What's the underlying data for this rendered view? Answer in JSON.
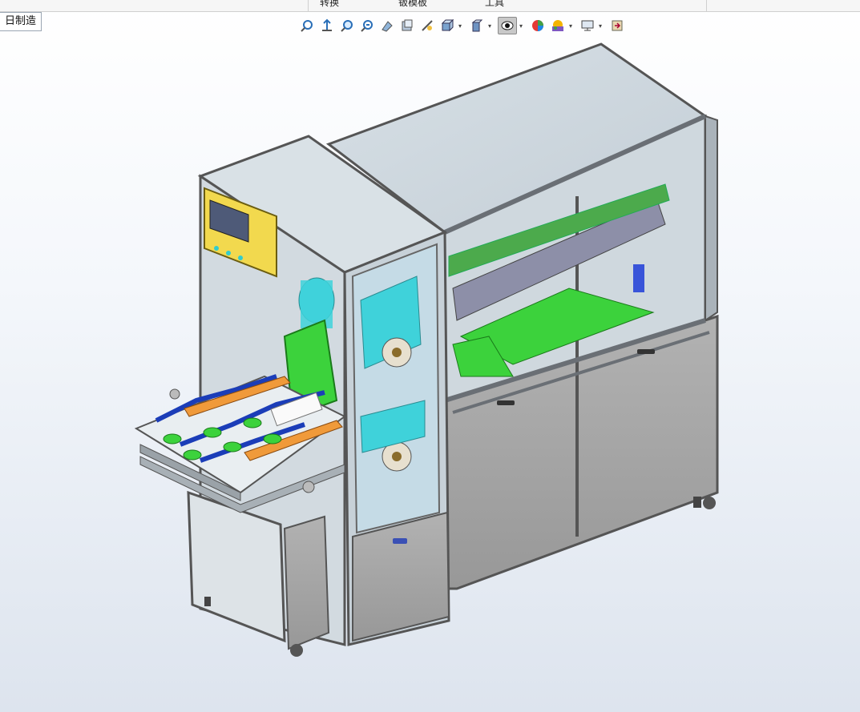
{
  "command_tabs": [
    {
      "label": "转换"
    },
    {
      "label": "钣模板"
    },
    {
      "label": "工具"
    }
  ],
  "document_tab": {
    "label": "日制造"
  },
  "heads_up_toolbar": {
    "tools": [
      {
        "icon": "zoom-to-fit-icon"
      },
      {
        "icon": "previous-view-icon"
      },
      {
        "icon": "zoom-to-area-icon"
      },
      {
        "icon": "zoom-in-out-icon"
      },
      {
        "icon": "section-view-icon"
      },
      {
        "icon": "dynamic-annotation-icon"
      },
      {
        "icon": "view-settings-icon"
      },
      {
        "icon": "view-orientation-icon"
      },
      {
        "icon": "display-style-icon"
      },
      {
        "icon": "hide-show-items-icon"
      },
      {
        "icon": "edit-appearance-icon"
      },
      {
        "icon": "apply-scene-icon"
      },
      {
        "icon": "view-setting-display-icon"
      },
      {
        "icon": "rotate-view-icon"
      }
    ]
  },
  "viewport": {
    "model": "3D assembly of automated machine with aluminum frame enclosure",
    "colors": {
      "frame": "#8c9096",
      "glass": "#c9d3da",
      "panel": "#a3a3a3",
      "hmi_yellow": "#f2d94e",
      "roll_cyan": "#3fd2da",
      "plate_green": "#3cd23c",
      "arm_orange": "#f09a3a",
      "belt_blue": "#1b3db8"
    }
  }
}
